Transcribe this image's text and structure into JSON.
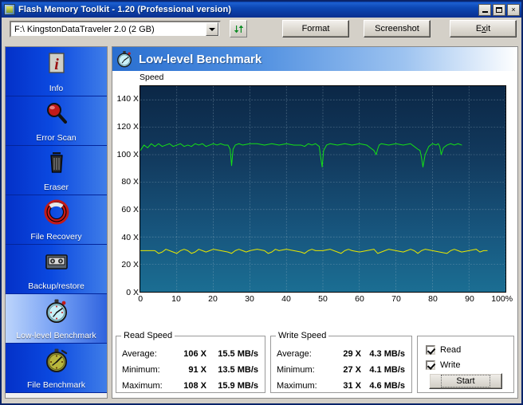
{
  "window": {
    "title": "Flash Memory Toolkit - 1.20 (Professional version)",
    "icon": "app-icon",
    "minimize_label": "Minimize",
    "maximize_label": "Maximize",
    "close_label": "×"
  },
  "toolbar": {
    "drive_value": "F:\\ KingstonDataTraveler 2.0 (2 GB)",
    "drive_placeholder": "Select drive",
    "refresh_icon": "refresh-icon",
    "format_label": "Format",
    "screenshot_label": "Screenshot",
    "exit_label_pre": "E",
    "exit_label_acc": "x",
    "exit_label_post": "it"
  },
  "sidebar": {
    "items": [
      {
        "label": "Info",
        "icon": "info-document-icon",
        "selected": false
      },
      {
        "label": "Error Scan",
        "icon": "magnifier-icon",
        "selected": false
      },
      {
        "label": "Eraser",
        "icon": "trash-can-icon",
        "selected": false
      },
      {
        "label": "File Recovery",
        "icon": "lifebuoy-icon",
        "selected": false
      },
      {
        "label": "Backup/restore",
        "icon": "cassette-tape-icon",
        "selected": false
      },
      {
        "label": "Low-level Benchmark",
        "icon": "stopwatch-blue-icon",
        "selected": true
      },
      {
        "label": "File Benchmark",
        "icon": "stopwatch-yellow-icon",
        "selected": false
      }
    ]
  },
  "panel": {
    "title": "Low-level Benchmark",
    "icon": "stopwatch-blue-icon"
  },
  "chart_data": {
    "type": "line",
    "title": "",
    "xlabel": "",
    "ylabel": "Speed",
    "xlim": [
      0,
      100
    ],
    "ylim": [
      0,
      150
    ],
    "grid": true,
    "legend": "none",
    "x_tick_labels": [
      "0",
      "10",
      "20",
      "30",
      "40",
      "50",
      "60",
      "70",
      "80",
      "90",
      "100%"
    ],
    "x_ticks": [
      0,
      10,
      20,
      30,
      40,
      50,
      60,
      70,
      80,
      90,
      100
    ],
    "y_tick_labels": [
      "0 X",
      "20 X",
      "40 X",
      "60 X",
      "80 X",
      "100 X",
      "120 X",
      "140 X"
    ],
    "y_ticks": [
      0,
      20,
      40,
      60,
      80,
      100,
      120,
      140
    ],
    "series": [
      {
        "name": "Read Speed",
        "color": "#15e015",
        "x": [
          0,
          1,
          2,
          3,
          4,
          5,
          6,
          7,
          8,
          9,
          10,
          11,
          12,
          13,
          14,
          15,
          16,
          17,
          18,
          19,
          20,
          21,
          22,
          23,
          24,
          24.6,
          25,
          25.4,
          26,
          27,
          28,
          30,
          32,
          34,
          36,
          38,
          40,
          42,
          44,
          45,
          46,
          47,
          48,
          49,
          49.4,
          49.8,
          50.2,
          51,
          52,
          54,
          56,
          58,
          60,
          62,
          63,
          64,
          64.6,
          65,
          65.4,
          66,
          68,
          70,
          72,
          74,
          75,
          76,
          76.6,
          77,
          77.4,
          78,
          79,
          80,
          81,
          81.6,
          82,
          82.4,
          83,
          84,
          85,
          86,
          87,
          88
        ],
        "y": [
          103,
          107,
          105,
          108,
          106,
          108,
          106,
          107,
          108,
          106,
          107,
          108,
          106,
          107,
          106,
          108,
          107,
          108,
          106,
          107,
          108,
          107,
          108,
          107,
          107,
          104,
          92,
          104,
          107,
          108,
          107,
          108,
          108,
          107,
          108,
          107,
          108,
          107,
          107,
          106,
          108,
          107,
          108,
          106,
          98,
          91,
          103,
          107,
          108,
          107,
          108,
          107,
          108,
          107,
          105,
          103,
          100,
          104,
          107,
          108,
          107,
          108,
          107,
          108,
          106,
          104,
          103,
          98,
          91,
          100,
          106,
          108,
          107,
          108,
          106,
          100,
          105,
          107,
          108,
          107,
          108,
          107,
          107
        ]
      },
      {
        "name": "Write Speed",
        "color": "#e8e800",
        "x": [
          0,
          2,
          4,
          5,
          6,
          7,
          8,
          9,
          10,
          11,
          12,
          13,
          14,
          15,
          16,
          17,
          18,
          19,
          20,
          22,
          24,
          25,
          26,
          27,
          28,
          29,
          30,
          32,
          34,
          35,
          36,
          37,
          38,
          40,
          42,
          44,
          45,
          46,
          47,
          48,
          50,
          52,
          54,
          55,
          56,
          57,
          58,
          60,
          62,
          64,
          65,
          66,
          67,
          68,
          70,
          72,
          74,
          75,
          76,
          77,
          78,
          80,
          82,
          84,
          85,
          86,
          87,
          88,
          90,
          92,
          93,
          94,
          95
        ],
        "y": [
          30,
          30,
          30,
          28,
          29,
          31,
          30,
          29,
          28,
          30,
          31,
          30,
          28,
          29,
          31,
          30,
          29,
          30,
          31,
          30,
          29,
          28,
          30,
          31,
          30,
          29,
          30,
          31,
          30,
          28,
          29,
          31,
          30,
          31,
          30,
          29,
          28,
          30,
          31,
          30,
          30,
          31,
          29,
          28,
          30,
          31,
          30,
          29,
          30,
          31,
          28,
          29,
          30,
          31,
          30,
          29,
          31,
          30,
          28,
          30,
          31,
          30,
          29,
          28,
          30,
          31,
          30,
          29,
          30,
          31,
          29,
          30,
          30
        ]
      }
    ]
  },
  "results": {
    "read": {
      "title": "Read Speed",
      "rows": [
        {
          "label": "Average:",
          "x": "106 X",
          "mb": "15.5 MB/s"
        },
        {
          "label": "Minimum:",
          "x": "91 X",
          "mb": "13.5 MB/s"
        },
        {
          "label": "Maximum:",
          "x": "108 X",
          "mb": "15.9 MB/s"
        }
      ]
    },
    "write": {
      "title": "Write Speed",
      "rows": [
        {
          "label": "Average:",
          "x": "29 X",
          "mb": "4.3 MB/s"
        },
        {
          "label": "Minimum:",
          "x": "27 X",
          "mb": "4.1 MB/s"
        },
        {
          "label": "Maximum:",
          "x": "31 X",
          "mb": "4.6 MB/s"
        }
      ]
    },
    "options": {
      "read_label": "Read",
      "read_checked": true,
      "write_label": "Write",
      "write_checked": true,
      "start_label": "Start"
    }
  }
}
